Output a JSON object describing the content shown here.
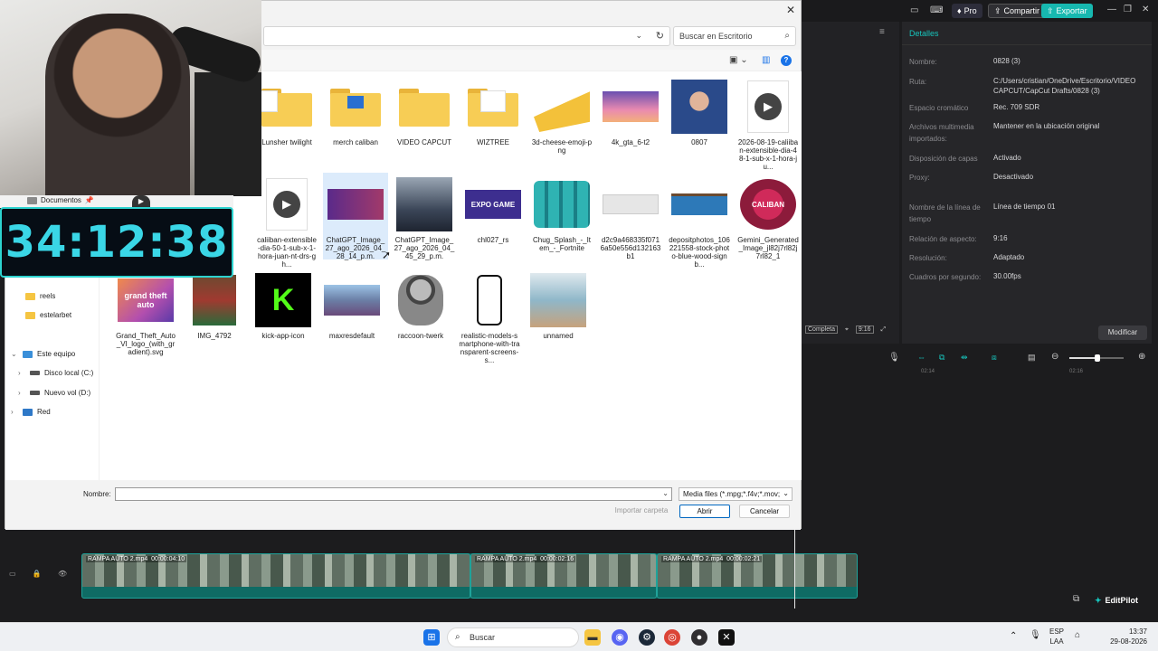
{
  "capcut": {
    "top_buttons": {
      "pro": "Pro",
      "share": "Compartir",
      "export": "Exportar"
    },
    "details": {
      "title": "Detalles",
      "rows": [
        {
          "key": "Nombre:",
          "value": "0828 (3)"
        },
        {
          "key": "Ruta:",
          "value": "C:/Users/cristian/OneDrive/Escritorio/VIDEO CAPCUT/CapCut Drafts/0828 (3)"
        },
        {
          "key": "Espacio cromático",
          "value": "Rec. 709 SDR"
        },
        {
          "key": "Archivos multimedia importados:",
          "value": "Mantener en la ubicación original"
        },
        {
          "key": "Disposición de capas",
          "value": "Activado"
        },
        {
          "key": "Proxy:",
          "value": "Desactivado"
        },
        {
          "key": "Nombre de la línea de tiempo",
          "value": "Línea de tiempo 01"
        },
        {
          "key": "Relación de aspecto:",
          "value": "9:16"
        },
        {
          "key": "Resolución:",
          "value": "Adaptado"
        },
        {
          "key": "Cuadros por segundo:",
          "value": "30.00fps"
        }
      ],
      "modify_button": "Modificar"
    },
    "player": {
      "complete_label": "Completa",
      "ratio_label": "9:16"
    },
    "timeline": {
      "ruler": [
        "02:14",
        "02:16"
      ],
      "clips": [
        {
          "name": "RAMPA AUTO 2.mp4",
          "duration": "00:00:04:10"
        },
        {
          "name": "RAMPA AUTO 2.mp4",
          "duration": "00:00:02:16"
        },
        {
          "name": "RAMPA AUTO 2.mp4",
          "duration": "00:00:02:21"
        }
      ],
      "editpilot": "EditPilot"
    }
  },
  "dialog": {
    "search_placeholder": "Buscar en Escritorio",
    "nav": {
      "documents": "Documentos",
      "reels": "reels",
      "estelarbet": "estelarbet",
      "this_pc": "Este equipo",
      "disk_c": "Disco local (C:)",
      "disk_d": "Nuevo vol (D:)",
      "network": "Red"
    },
    "files": [
      {
        "name": "Lunsher twilight",
        "kind": "folder"
      },
      {
        "name": "merch caliban",
        "kind": "folder"
      },
      {
        "name": "VIDEO CAPCUT",
        "kind": "folder"
      },
      {
        "name": "WIZTREE",
        "kind": "folder"
      },
      {
        "name": "3d-cheese-emoji-png",
        "kind": "image",
        "color": "#f3c13a"
      },
      {
        "name": "4k_gta_6-t2",
        "kind": "image",
        "color": "#c76a9c"
      },
      {
        "name": "0807",
        "kind": "image",
        "color": "#2a4a8a"
      },
      {
        "name": "2026-08-19-caliiban-extensible-dia-48-1-sub-x-1-hora-ju...",
        "kind": "video"
      },
      {
        "name": "caliiban-extensible-dia-50-1-sub-x-1-hora-juan-nt-drs-gh...",
        "kind": "video"
      },
      {
        "name": "ChatGPT_Image_27_ago_2026_04_28_14_p.m.",
        "kind": "image",
        "color": "#5a3a8a"
      },
      {
        "name": "ChatGPT_Image_27_ago_2026_04_45_29_p.m.",
        "kind": "image",
        "color": "#3b4658"
      },
      {
        "name": "chl027_rs",
        "kind": "image",
        "color": "#3d2e8f"
      },
      {
        "name": "Chug_Splash_-_Item_-_Fortnite",
        "kind": "image",
        "color": "#2fb3b3"
      },
      {
        "name": "d2c9a468335f0716a50e556d132163b1",
        "kind": "image",
        "color": "#e6e6e6"
      },
      {
        "name": "depositphotos_106221558-stock-photo-blue-wood-signb...",
        "kind": "image",
        "color": "#2d79b8"
      },
      {
        "name": "Gemini_Generated_Image_jl82j7rl82j7rl82_1",
        "kind": "image",
        "color": "#8c1b3b"
      },
      {
        "name": "Grand_Theft_Auto_VI_logo_(with_gradient).svg",
        "kind": "image",
        "color": "#b34fae"
      },
      {
        "name": "IMG_4792",
        "kind": "image",
        "color": "#6b4a30"
      },
      {
        "name": "kick-app-icon",
        "kind": "image",
        "color": "#000000"
      },
      {
        "name": "maxresdefault",
        "kind": "image",
        "color": "#6b7fa6"
      },
      {
        "name": "raccoon-twerk",
        "kind": "image",
        "color": "#777777"
      },
      {
        "name": "realistic-models-smartphone-with-transparent-screens-s...",
        "kind": "image",
        "color": "#ffffff"
      },
      {
        "name": "unnamed",
        "kind": "image",
        "color": "#8fb7c9"
      }
    ],
    "thumb_text": {
      "expo": "EXPO GAME",
      "caliban": "CALIBAN",
      "gta": "grand theft auto",
      "kick": "K"
    },
    "bottom": {
      "name_label": "Nombre:",
      "name_value": "",
      "filter_value": "Media files (*.mpg;*.f4v;*.mov;",
      "import_folder": "Importar carpeta",
      "open": "Abrir",
      "cancel": "Cancelar"
    }
  },
  "overlay": {
    "timer": "34:12:38"
  },
  "taskbar": {
    "search": "Buscar",
    "lang_top": "ESP",
    "lang_bottom": "LAA",
    "time": "13:37",
    "date": "29-08-2026"
  }
}
